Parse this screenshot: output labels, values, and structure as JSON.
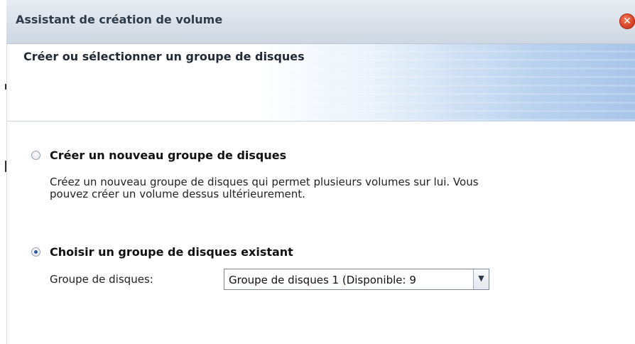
{
  "window": {
    "title": "Assistant de création de volume",
    "close_icon": "close-icon",
    "close_color": "#d8452b"
  },
  "header": {
    "title": "Créer ou sélectionner un groupe de disques"
  },
  "options": [
    {
      "label": "Créer un nouveau groupe de disques",
      "selected": false,
      "description_lines": [
        "Créez un nouveau groupe de disques qui permet plusieurs volumes sur lui. Vous",
        "pouvez créer un volume dessus ultérieurement."
      ]
    },
    {
      "label": "Choisir un groupe de disques existant",
      "selected": true
    }
  ],
  "disk_group": {
    "label": "Groupe de disques:",
    "value": "Groupe de disques 1 (Disponible: 9",
    "arrow_icon": "chevron-down-icon"
  }
}
